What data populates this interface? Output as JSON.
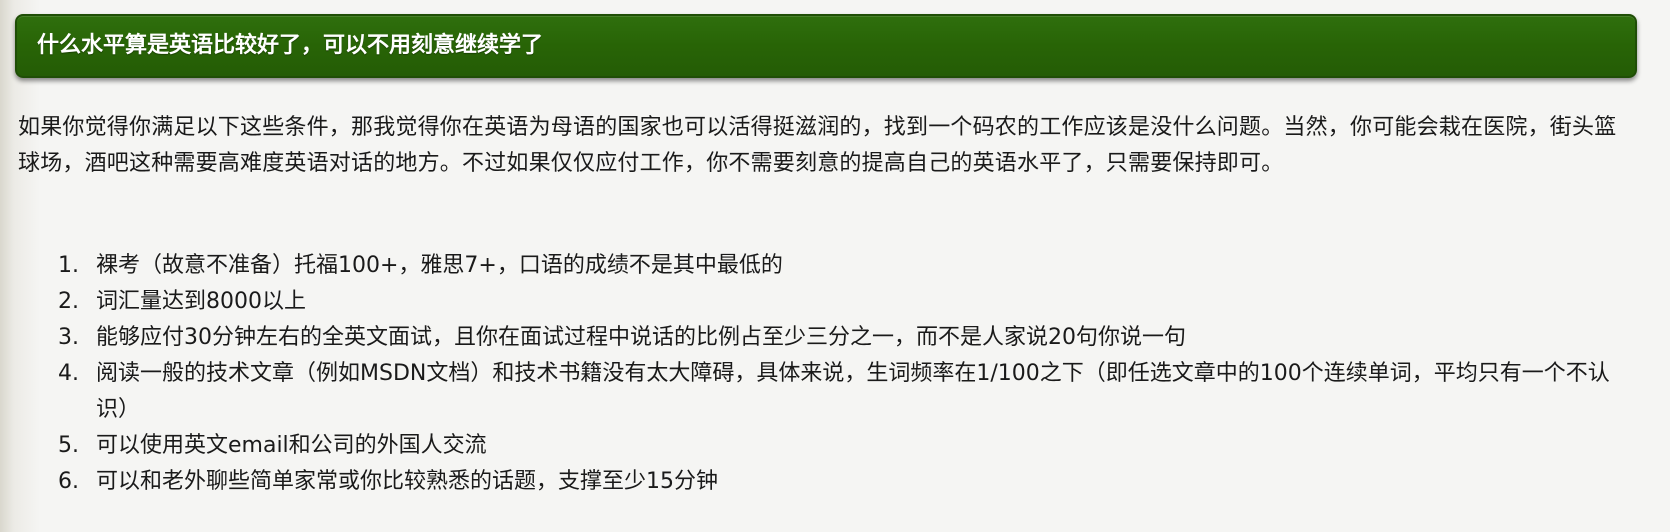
{
  "heading": {
    "title": "什么水平算是英语比较好了，可以不用刻意继续学了"
  },
  "intro": {
    "text": "如果你觉得你满足以下这些条件，那我觉得你在英语为母语的国家也可以活得挺滋润的，找到一个码农的工作应该是没什么问题。当然，你可能会栽在医院，街头篮球场，酒吧这种需要高难度英语对话的地方。不过如果仅仅应付工作，你不需要刻意的提高自己的英语水平了，只需要保持即可。"
  },
  "criteria": [
    {
      "number": "1.",
      "text": "裸考（故意不准备）托福100+，雅思7+，口语的成绩不是其中最低的"
    },
    {
      "number": "2.",
      "text": "词汇量达到8000以上"
    },
    {
      "number": "3.",
      "text": "能够应付30分钟左右的全英文面试，且你在面试过程中说话的比例占至少三分之一，而不是人家说20句你说一句"
    },
    {
      "number": "4.",
      "text": "阅读一般的技术文章（例如MSDN文档）和技术书籍没有太大障碍，具体来说，生词频率在1/100之下（即任选文章中的100个连续单词，平均只有一个不认识）"
    },
    {
      "number": "5.",
      "text": "可以使用英文email和公司的外国人交流"
    },
    {
      "number": "6.",
      "text": "可以和老外聊些简单家常或你比较熟悉的话题，支撑至少15分钟"
    }
  ],
  "colors": {
    "heading_bg": "#286406",
    "heading_text": "#ffffff",
    "page_bg": "#f5f5f3",
    "body_text": "#1a1a1a"
  }
}
